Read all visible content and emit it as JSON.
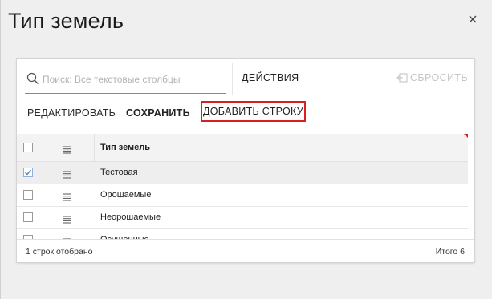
{
  "dialog": {
    "title": "Тип земель",
    "close_icon": "close-icon"
  },
  "search": {
    "placeholder": "Поиск: Все текстовые столбцы",
    "value": "",
    "icon": "search-icon"
  },
  "toolbar": {
    "actions_label": "ДЕЙСТВИЯ",
    "reset_label": "СБРОСИТЬ",
    "reset_icon": "reset-icon",
    "edit_label": "РЕДАКТИРОВАТЬ",
    "save_label": "СОХРАНИТЬ",
    "add_row_label": "ДОБАВИТЬ СТРОКУ",
    "highlight_color": "#dd1e1e"
  },
  "grid": {
    "column_header": "Тип земель",
    "rows": [
      {
        "value": "Тестовая",
        "selected": true
      },
      {
        "value": "Орошаемые",
        "selected": false
      },
      {
        "value": "Неорошаемые",
        "selected": false
      },
      {
        "value": "Осушенные",
        "selected": false
      }
    ]
  },
  "footer": {
    "rows_shown": "1 строк отобрано",
    "total": "Итого 6"
  }
}
